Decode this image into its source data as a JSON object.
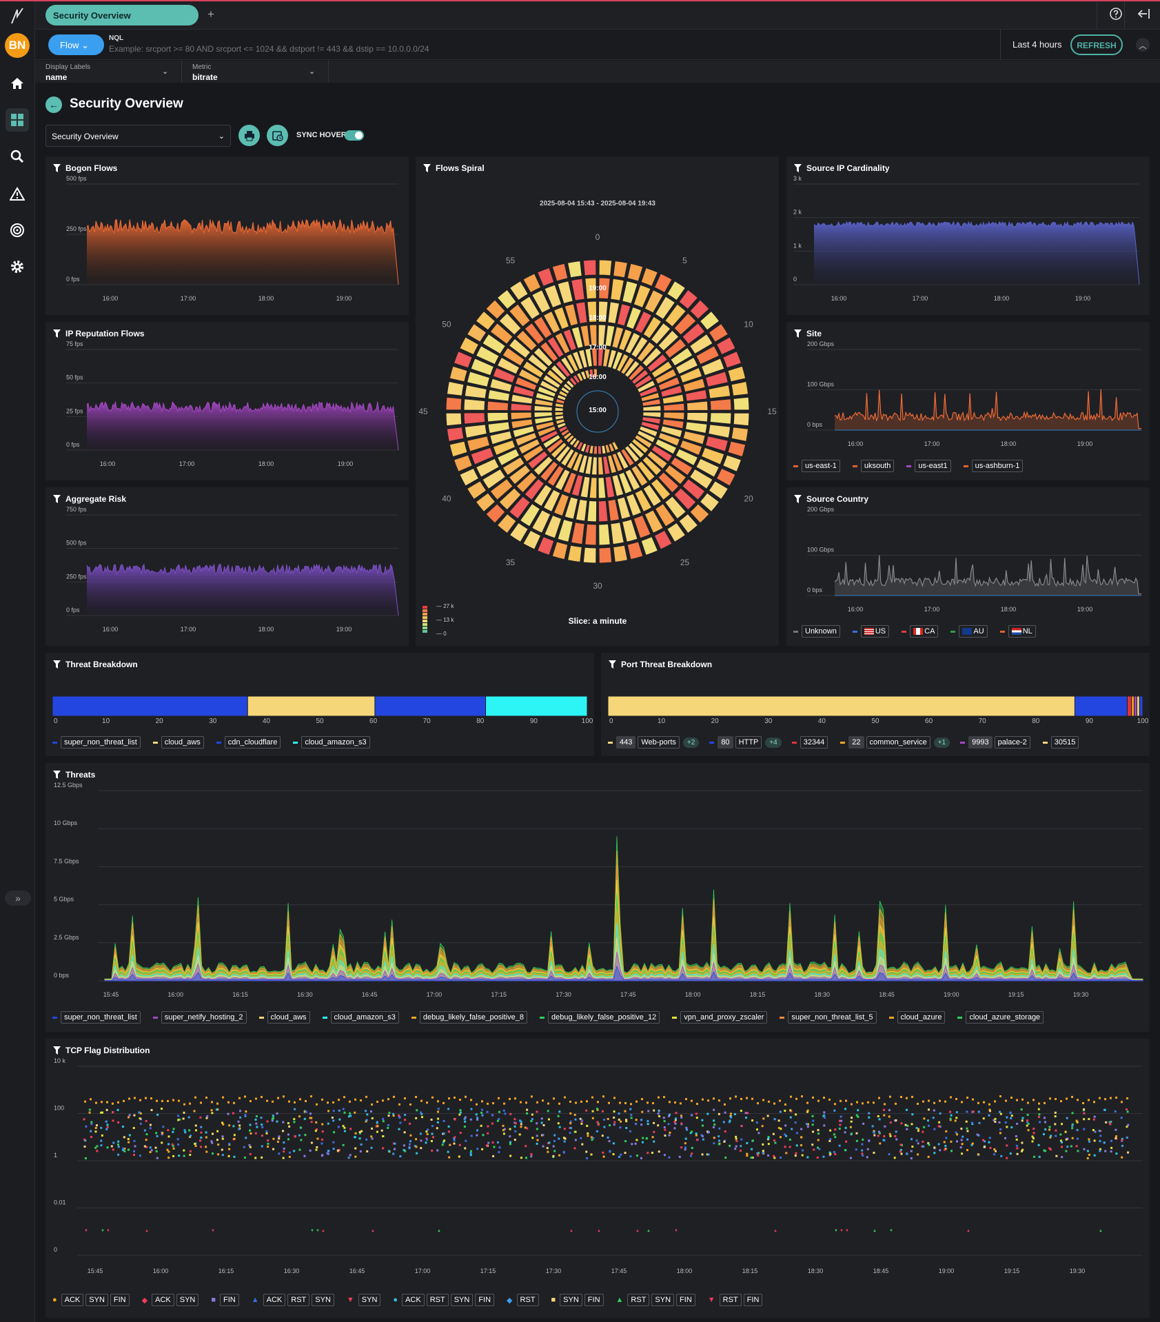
{
  "app": {
    "tab_title": "Security Overview",
    "avatar_initials": "BN"
  },
  "query": {
    "mode": "Flow",
    "label": "NQL",
    "placeholder": "Example: srcport >= 80 AND srcport <= 1024 && dstport != 443 && dstip == 10.0.0.0/24",
    "time_range": "Last 4 hours",
    "refresh": "REFRESH"
  },
  "filters": {
    "display_labels_label": "Display Labels",
    "display_labels_value": "name",
    "metric_label": "Metric",
    "metric_value": "bitrate"
  },
  "page": {
    "title": "Security Overview",
    "dashboard_select": "Security Overview",
    "sync_hover": "SYNC HOVER",
    "sync_on": true
  },
  "colors": {
    "accent": "#5cbdb1",
    "flow_button": "#3b9ff0",
    "bogon": "#e8683a",
    "iprep": "#a548c4",
    "risk": "#7c4fc4",
    "cardinality": "#5a62c8",
    "site": "#e0622f",
    "country": "#777"
  },
  "charts": {
    "bogon": {
      "title": "Bogon Flows",
      "yticks": [
        "500 fps",
        "250 fps",
        "0 fps"
      ],
      "xticks": [
        "16:00",
        "17:00",
        "18:00",
        "19:00"
      ]
    },
    "iprep": {
      "title": "IP Reputation Flows",
      "yticks": [
        "75 fps",
        "50 fps",
        "25 fps",
        "0 fps"
      ],
      "xticks": [
        "16:00",
        "17:00",
        "18:00",
        "19:00"
      ]
    },
    "risk": {
      "title": "Aggregate Risk",
      "yticks": [
        "750 fps",
        "500 fps",
        "250 fps",
        "0 fps"
      ],
      "xticks": [
        "16:00",
        "17:00",
        "18:00",
        "19:00"
      ]
    },
    "cardinality": {
      "title": "Source IP Cardinality",
      "yticks": [
        "3 k",
        "2 k",
        "1 k",
        "0"
      ],
      "xticks": [
        "16:00",
        "17:00",
        "18:00",
        "19:00"
      ]
    },
    "site": {
      "title": "Site",
      "yticks": [
        "200 Gbps",
        "100 Gbps",
        "0 bps"
      ],
      "xticks": [
        "16:00",
        "17:00",
        "18:00",
        "19:00"
      ],
      "legend": [
        "us-east-1",
        "uksouth",
        "us-east1",
        "us-ashburn-1"
      ],
      "legend_colors": [
        "#e0622f",
        "#e0622f",
        "#a548c4",
        "#e0622f"
      ]
    },
    "country": {
      "title": "Source Country",
      "yticks": [
        "200 Gbps",
        "100 Gbps",
        "0 bps"
      ],
      "xticks": [
        "16:00",
        "17:00",
        "18:00",
        "19:00"
      ],
      "legend": [
        "Unknown",
        "US",
        "CA",
        "AU",
        "NL"
      ],
      "legend_colors": [
        "#777",
        "#3b6fe0",
        "#e03c3c",
        "#2f9e44",
        "#e0622f"
      ]
    },
    "spiral": {
      "title": "Flows Spiral",
      "range": "2025-08-04 15:43 - 2025-08-04 19:43",
      "ring_labels": [
        "19:00",
        "18:00",
        "17:00",
        "16:00",
        "15:00"
      ],
      "minute_labels": [
        "0",
        "5",
        "10",
        "15",
        "20",
        "25",
        "30",
        "35",
        "40",
        "45",
        "50",
        "55"
      ],
      "slice": "Slice: a minute",
      "scale": [
        "27 k",
        "13 k",
        "0"
      ]
    },
    "threat_breakdown": {
      "title": "Threat Breakdown",
      "xticks": [
        "0",
        "10",
        "20",
        "30",
        "40",
        "50",
        "60",
        "70",
        "80",
        "90",
        "100"
      ],
      "segments": [
        {
          "name": "super_non_threat_list",
          "value": 36.5,
          "color": "#2446e0"
        },
        {
          "name": "cloud_aws",
          "value": 23.8,
          "color": "#f5d77a"
        },
        {
          "name": "cdn_cloudflare",
          "value": 20.7,
          "color": "#2446e0"
        },
        {
          "name": "cloud_amazon_s3",
          "value": 19.0,
          "color": "#2ef5f5"
        }
      ],
      "legend_colors": [
        "#2446e0",
        "#f5d77a",
        "#2446e0",
        "#2ef5f5"
      ]
    },
    "port_breakdown": {
      "title": "Port Threat Breakdown",
      "xticks": [
        "0",
        "10",
        "20",
        "30",
        "40",
        "50",
        "60",
        "70",
        "80",
        "90",
        "100"
      ],
      "segments": [
        {
          "value": 87.3,
          "color": "#f5d77a"
        },
        {
          "value": 9.8,
          "color": "#2446e0"
        },
        {
          "value": 0.8,
          "color": "#e0323c"
        },
        {
          "value": 0.5,
          "color": "#f5a623"
        },
        {
          "value": 0.5,
          "color": "#a548c4"
        },
        {
          "value": 0.5,
          "color": "#f5d77a"
        },
        {
          "value": 0.6,
          "color": "#2446e0"
        }
      ],
      "legend": [
        {
          "port": "443",
          "name": "Web-ports",
          "more": "+2",
          "color": "#f5d77a"
        },
        {
          "port": "80",
          "name": "HTTP",
          "more": "+4",
          "color": "#2446e0"
        },
        {
          "port": "",
          "name": "32344",
          "more": "",
          "color": "#e0323c"
        },
        {
          "port": "22",
          "name": "common_service",
          "more": "+1",
          "color": "#f5a623"
        },
        {
          "port": "9993",
          "name": "palace-2",
          "more": "",
          "color": "#a548c4"
        },
        {
          "port": "",
          "name": "30515",
          "more": "",
          "color": "#f5d77a"
        }
      ]
    },
    "threats": {
      "title": "Threats",
      "yticks": [
        "12.5 Gbps",
        "10 Gbps",
        "7.5 Gbps",
        "5 Gbps",
        "2.5 Gbps",
        "0 bps"
      ],
      "xticks": [
        "15:45",
        "16:00",
        "16:15",
        "16:30",
        "16:45",
        "17:00",
        "17:15",
        "17:30",
        "17:45",
        "18:00",
        "18:15",
        "18:30",
        "18:45",
        "19:00",
        "19:15",
        "19:30"
      ],
      "legend": [
        "super_non_threat_list",
        "super_netify_hosting_2",
        "cloud_aws",
        "cloud_amazon_s3",
        "debug_likely_false_positive_8",
        "debug_likely_false_positive_12",
        "vpn_and_proxy_zscaler",
        "super_non_threat_list_5",
        "cloud_azure",
        "cloud_azure_storage"
      ],
      "legend_colors": [
        "#2446e0",
        "#a548c4",
        "#f5d77a",
        "#2ef5f5",
        "#f5a623",
        "#2fd05a",
        "#e6e23a",
        "#f08a3a",
        "#f5a623",
        "#2fd05a"
      ]
    },
    "tcp": {
      "title": "TCP Flag Distribution",
      "yticks": [
        "10 k",
        "100",
        "1",
        "0.01",
        "0"
      ],
      "xticks": [
        "15:45",
        "16:00",
        "16:15",
        "16:30",
        "16:45",
        "17:00",
        "17:15",
        "17:30",
        "17:45",
        "18:00",
        "18:15",
        "18:30",
        "18:45",
        "19:00",
        "19:15",
        "19:30"
      ],
      "legend": [
        {
          "marker": "●",
          "color": "#f5a623",
          "flags": [
            "ACK",
            "SYN",
            "FIN"
          ]
        },
        {
          "marker": "◆",
          "color": "#f03c5a",
          "flags": [
            "ACK",
            "SYN"
          ]
        },
        {
          "marker": "■",
          "color": "#8a7be0",
          "flags": [
            "FIN"
          ]
        },
        {
          "marker": "▲",
          "color": "#3b6fe0",
          "flags": [
            "ACK",
            "RST",
            "SYN"
          ]
        },
        {
          "marker": "▼",
          "color": "#f03c5a",
          "flags": [
            "SYN"
          ]
        },
        {
          "marker": "●",
          "color": "#2ec5e0",
          "flags": [
            "ACK",
            "RST",
            "SYN",
            "FIN"
          ]
        },
        {
          "marker": "◆",
          "color": "#3b9ff0",
          "flags": [
            "RST"
          ]
        },
        {
          "marker": "■",
          "color": "#f5d77a",
          "flags": [
            "SYN",
            "FIN"
          ]
        },
        {
          "marker": "▲",
          "color": "#2fd05a",
          "flags": [
            "RST",
            "SYN",
            "FIN"
          ]
        },
        {
          "marker": "▼",
          "color": "#f03c5a",
          "flags": [
            "RST",
            "FIN"
          ]
        }
      ]
    }
  }
}
